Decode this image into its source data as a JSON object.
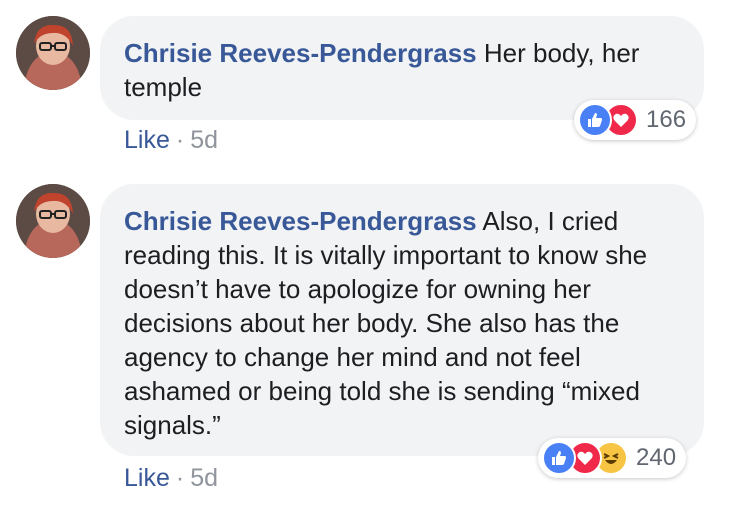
{
  "comments": [
    {
      "author": "Chrisie Reeves-Pendergrass",
      "text": "Her body, her temple",
      "like_label": "Like",
      "separator": "·",
      "time": "5d",
      "reaction_count": "166",
      "reactions": [
        "like-icon",
        "love-icon"
      ]
    },
    {
      "author": "Chrisie Reeves-Pendergrass",
      "text": "Also, I cried reading this. It is vitally important to know she doesn’t have to apologize for owning her decisions about her body. She also has the agency to change her mind and not feel ashamed or being told she is sending “mixed signals.”",
      "like_label": "Like",
      "separator": "·",
      "time": "5d",
      "reaction_count": "240",
      "reactions": [
        "like-icon",
        "love-icon",
        "haha-icon"
      ]
    }
  ],
  "colors": {
    "author": "#385898",
    "bubble": "#f2f3f5",
    "like_reaction": "#4a80f5",
    "love_reaction": "#f0284a",
    "haha_reaction": "#f7c443"
  }
}
